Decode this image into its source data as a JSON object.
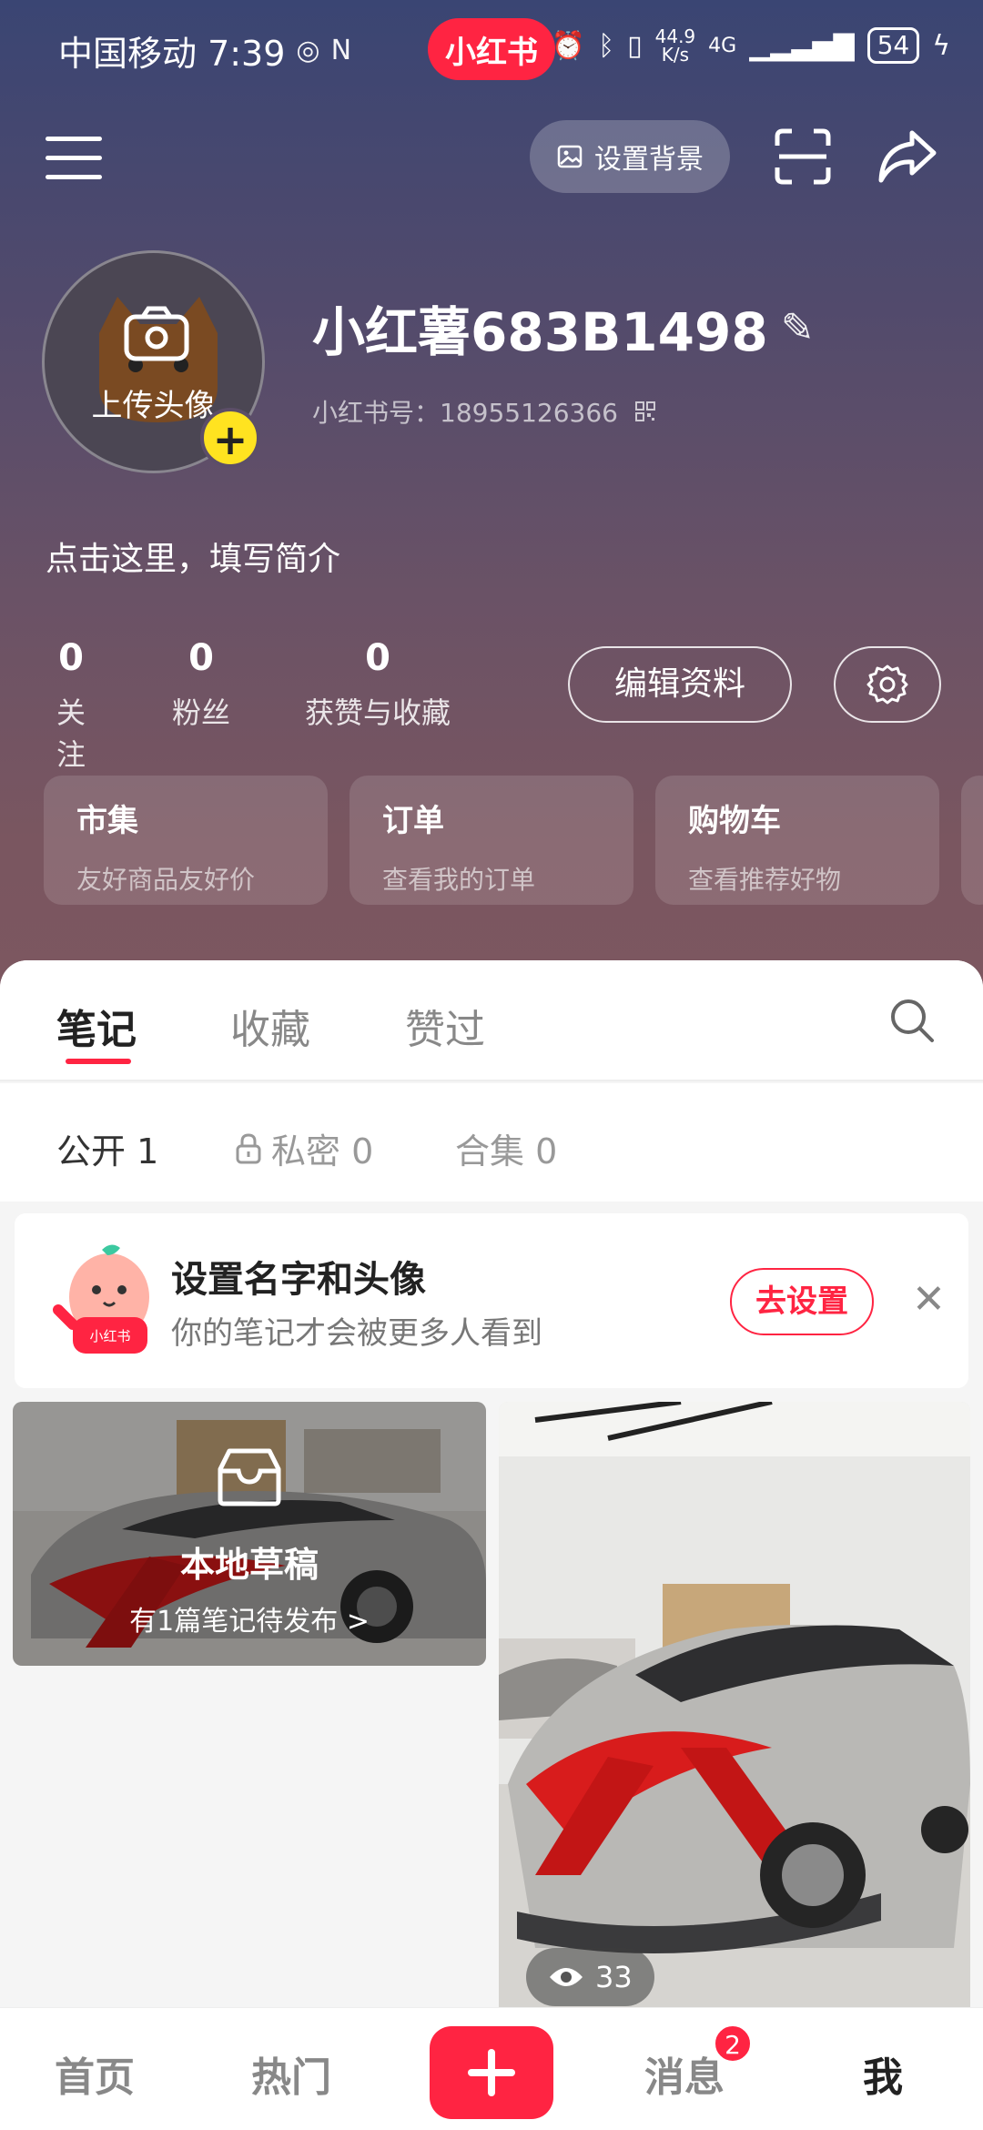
{
  "status_bar": {
    "carrier_time": "中国移动 7:39",
    "app_logo": "小红书",
    "net_speed_value": "44.9",
    "net_speed_unit": "K/s",
    "network": "4G",
    "battery": "54"
  },
  "topbar": {
    "menu_icon": "hamburger-menu-icon",
    "set_background_label": "设置背景",
    "scan_icon": "scan-icon",
    "share_icon": "share-icon"
  },
  "profile": {
    "avatar_label": "上传头像",
    "username": "小红薯683B1498",
    "redbook_id_label": "小红书号：",
    "redbook_id": "18955126366",
    "bio": "点击这里，填写简介",
    "stats": [
      {
        "num": "0",
        "label": "关注"
      },
      {
        "num": "0",
        "label": "粉丝"
      },
      {
        "num": "0",
        "label": "获赞与收藏"
      }
    ],
    "edit_label": "编辑资料"
  },
  "shortcuts": [
    {
      "title": "市集",
      "subtitle": "友好商品友好价"
    },
    {
      "title": "订单",
      "subtitle": "查看我的订单"
    },
    {
      "title": "购物车",
      "subtitle": "查看推荐好物"
    }
  ],
  "tabs": [
    {
      "label": "笔记",
      "active": true
    },
    {
      "label": "收藏",
      "active": false
    },
    {
      "label": "赞过",
      "active": false
    }
  ],
  "subtabs": [
    {
      "label": "公开 1",
      "active": true
    },
    {
      "label": "私密 0",
      "active": false
    },
    {
      "label": "合集 0",
      "active": false
    }
  ],
  "tip": {
    "title": "设置名字和头像",
    "subtitle": "你的笔记才会被更多人看到",
    "button": "去设置",
    "mascot_text": "小红书"
  },
  "draft_card": {
    "title": "本地草稿",
    "subtitle": "有1篇笔记待发布 >"
  },
  "note_card": {
    "views": "33"
  },
  "bottom_nav": {
    "items": [
      "首页",
      "热门",
      "消息",
      "我"
    ],
    "message_badge": "2"
  },
  "colors": {
    "accent": "#ff2442",
    "avatar_plus": "#ffe320"
  }
}
